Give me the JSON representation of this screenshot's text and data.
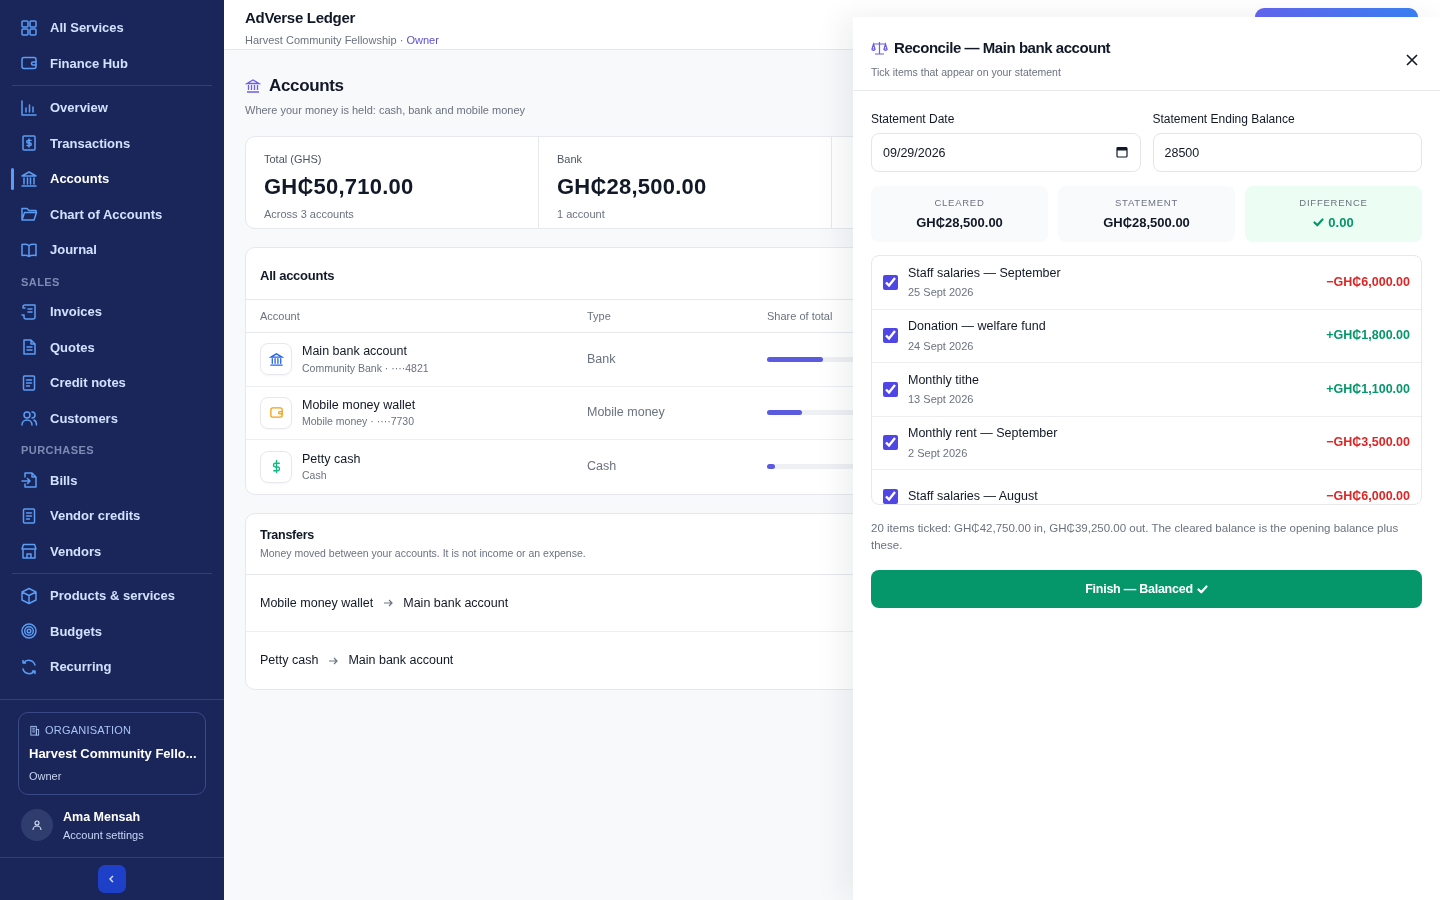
{
  "sidebar": {
    "groups": [
      {
        "items": [
          {
            "label": "All Services",
            "selected": false
          },
          {
            "label": "Finance Hub",
            "selected": false
          }
        ]
      },
      {
        "items": [
          {
            "label": "Overview",
            "selected": false
          },
          {
            "label": "Transactions",
            "selected": false
          },
          {
            "label": "Accounts",
            "selected": true
          },
          {
            "label": "Chart of Accounts",
            "selected": false
          },
          {
            "label": "Journal",
            "selected": false
          }
        ]
      },
      {
        "heading": "SALES",
        "items": [
          {
            "label": "Invoices",
            "selected": false
          },
          {
            "label": "Quotes",
            "selected": false
          },
          {
            "label": "Credit notes",
            "selected": false
          },
          {
            "label": "Customers",
            "selected": false
          }
        ]
      },
      {
        "heading": "PURCHASES",
        "items": [
          {
            "label": "Bills",
            "selected": false
          },
          {
            "label": "Vendor credits",
            "selected": false
          },
          {
            "label": "Vendors",
            "selected": false
          }
        ]
      },
      {
        "items": [
          {
            "label": "Products & services",
            "selected": false
          },
          {
            "label": "Budgets",
            "selected": false
          },
          {
            "label": "Recurring",
            "selected": false
          }
        ]
      }
    ],
    "organisation": {
      "label": "ORGANISATION",
      "name": "Harvest Community Fello...",
      "role": "Owner"
    },
    "user": {
      "name": "Ama Mensah",
      "link": "Account settings"
    }
  },
  "header": {
    "app_name": "AdVerse Ledger",
    "organisation": "Harvest Community Fellowship",
    "separator": "·",
    "role": "Owner"
  },
  "page": {
    "title": "Accounts",
    "subtitle": "Where your money is held: cash, bank and mobile money"
  },
  "stats": [
    {
      "label": "Total (GHS)",
      "value": "GH₵50,710.00",
      "note": "Across 3 accounts"
    },
    {
      "label": "Bank",
      "value": "GH₵28,500.00",
      "note": "1 account"
    }
  ],
  "accounts_table": {
    "title": "All accounts",
    "columns": [
      "Account",
      "Type",
      "Share of total"
    ],
    "rows": [
      {
        "name": "Main bank account",
        "detail": "Community Bank · ····4821",
        "type": "Bank",
        "level": 0.56
      },
      {
        "name": "Mobile money wallet",
        "detail": "Mobile money · ····7730",
        "type": "Mobile money",
        "level": 0.35
      },
      {
        "name": "Petty cash",
        "detail": "Cash",
        "type": "Cash",
        "level": 0.08
      }
    ]
  },
  "transfers": {
    "title": "Transfers",
    "subtitle": "Money moved between your accounts. It is not income or an expense.",
    "rows": [
      {
        "from": "Mobile money wallet",
        "to": "Main bank account"
      },
      {
        "from": "Petty cash",
        "to": "Main bank account"
      }
    ]
  },
  "reconcile_panel": {
    "title": "Reconcile — Main bank account",
    "subtitle": "Tick items that appear on your statement",
    "fields": [
      {
        "label": "Statement Date",
        "value": "09/29/2026",
        "kind": "date"
      },
      {
        "label": "Statement Ending Balance",
        "value": "28500",
        "kind": "number"
      }
    ],
    "tiles": [
      {
        "label": "CLEARED",
        "value": "GH₵28,500.00",
        "balanced": false
      },
      {
        "label": "STATEMENT",
        "value": "GH₵28,500.00",
        "balanced": false
      },
      {
        "label": "DIFFERENCE",
        "value": "0.00",
        "balanced": true
      }
    ],
    "items": [
      {
        "title": "Staff salaries — September",
        "date": "25 Sept 2026",
        "amount": "−GH₵6,000.00",
        "incoming": false,
        "checked": true
      },
      {
        "title": "Donation — welfare fund",
        "date": "24 Sept 2026",
        "amount": "+GH₵1,800.00",
        "incoming": true,
        "checked": true
      },
      {
        "title": "Monthly tithe",
        "date": "13 Sept 2026",
        "amount": "+GH₵1,100.00",
        "incoming": true,
        "checked": true
      },
      {
        "title": "Monthly rent — September",
        "date": "2 Sept 2026",
        "amount": "−GH₵3,500.00",
        "incoming": false,
        "checked": true
      },
      {
        "title": "Staff salaries — August",
        "amount": "−GH₵6,000.00",
        "incoming": false,
        "checked": true
      }
    ],
    "note": "20 items ticked: GH₵42,750.00 in, GH₵39,250.00 out. The cleared balance is the opening balance plus these.",
    "finish_button": "Finish — Balanced"
  }
}
